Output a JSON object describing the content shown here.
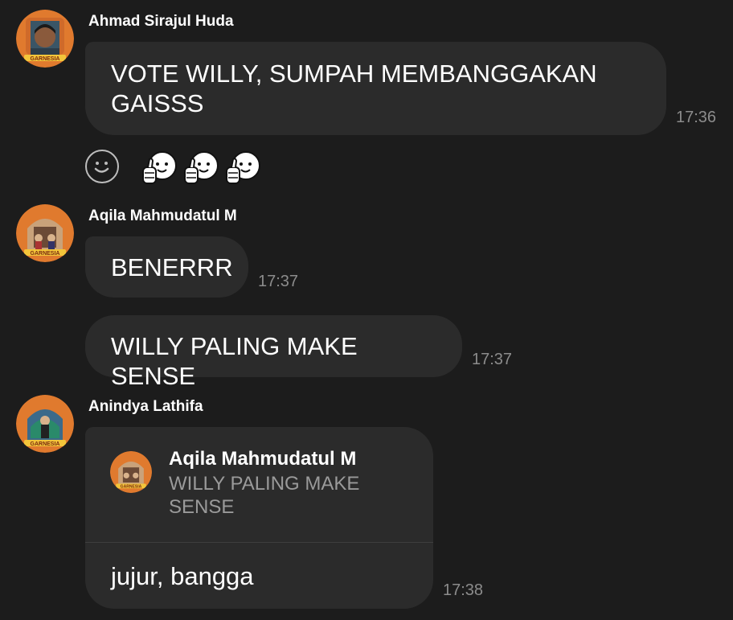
{
  "messages": [
    {
      "sender": "Ahmad Sirajul Huda",
      "avatar": "profile-photo",
      "text": "VOTE WILLY, SUMPAH MEMBANGGAKAN GAISSS",
      "time": "17:36"
    },
    {
      "sender": "Aqila Mahmudatul M",
      "avatar": "garnesia-group-avatar",
      "text": "BENERRR",
      "time": "17:37"
    },
    {
      "text": "WILLY PALING MAKE SENSE",
      "time": "17:37"
    },
    {
      "sender": "Anindya Lathifa",
      "avatar": "garnesia-group-avatar",
      "quote": {
        "sender": "Aqila Mahmudatul M",
        "text": "WILLY PALING MAKE SENSE"
      },
      "text": "jujur, bangga",
      "time": "17:38"
    }
  ],
  "reactions": {
    "add_icon": "smiley-icon",
    "stickers": [
      "thumbs-up-sticker",
      "thumbs-up-sticker",
      "thumbs-up-sticker"
    ]
  },
  "avatar_label": "GARNESIA",
  "colors": {
    "background": "#1c1c1c",
    "bubble": "#2b2b2b",
    "timestamp": "#8c8c8c",
    "quote_text": "#9a9a9a",
    "avatar_bg": "#e07a2e"
  }
}
